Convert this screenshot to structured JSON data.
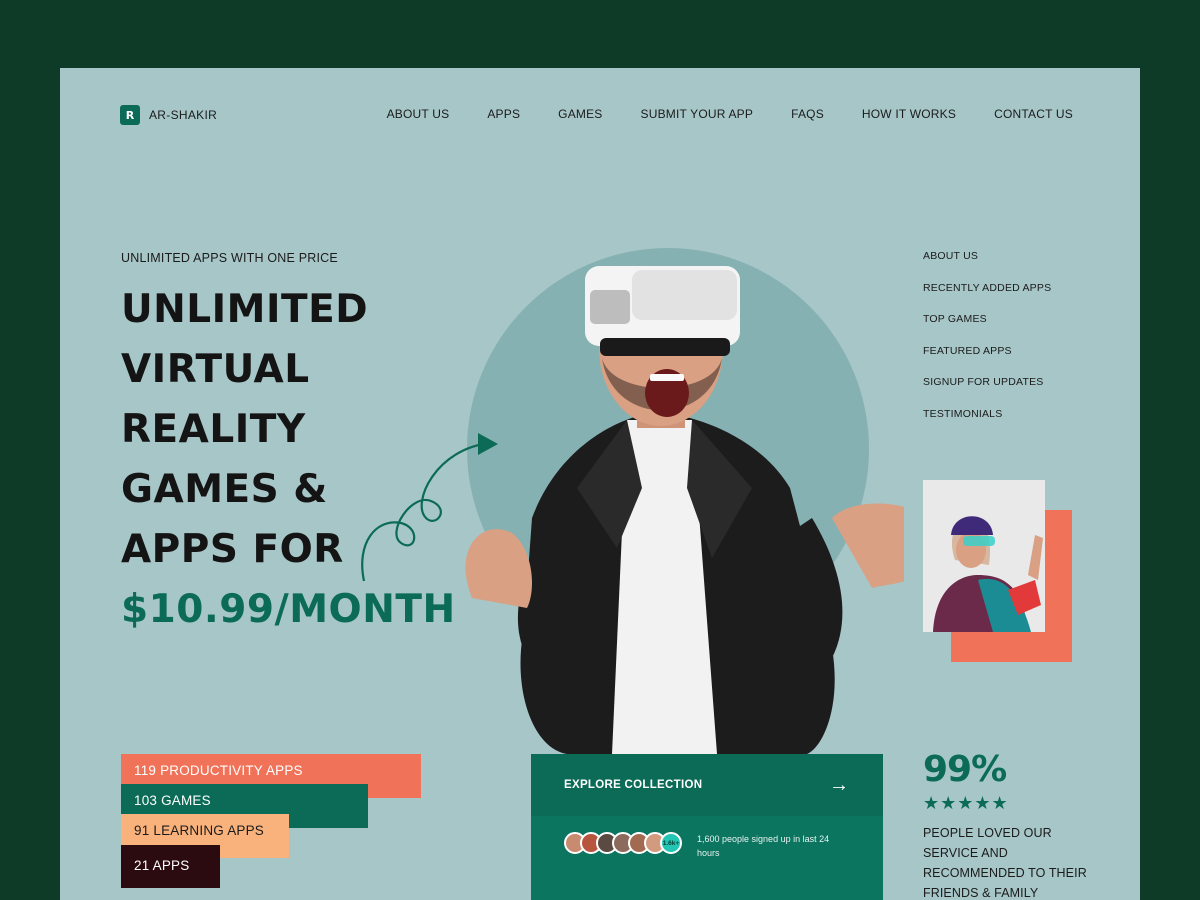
{
  "brand": {
    "name": "AR-SHAKIR",
    "logo_glyph": "R"
  },
  "nav": [
    "ABOUT US",
    "APPS",
    "GAMES",
    "SUBMIT YOUR APP",
    "FAQS",
    "HOW IT WORKS",
    "CONTACT US"
  ],
  "hero": {
    "eyebrow": "UNLIMITED APPS WITH ONE PRICE",
    "headline_lines": [
      "UNLIMITED",
      "VIRTUAL",
      "REALITY",
      "GAMES &",
      "APPS FOR"
    ],
    "price": "$10.99/MONTH"
  },
  "side_menu": [
    "ABOUT US",
    "RECENTLY ADDED APPS",
    "TOP GAMES",
    "FEATURED APPS",
    "SIGNUP FOR UPDATES",
    "TESTIMONIALS"
  ],
  "stats": [
    "119 PRODUCTIVITY APPS",
    "103 GAMES",
    "91 LEARNING APPS",
    "21 APPS"
  ],
  "explore": {
    "label": "EXPLORE COLLECTION",
    "arrow_icon": "→",
    "avatar_count": "1.6k+",
    "signup_text": "1,600 people signed up in last 24 hours"
  },
  "rating": {
    "percent": "99%",
    "stars": "★★★★★",
    "text": "PEOPLE LOVED OUR SERVICE AND RECOMMENDED TO THEIR FRIENDS & FAMILY"
  },
  "colors": {
    "frame": "#0d3b27",
    "page": "#a7c6c8",
    "primary_green": "#0b6b57",
    "coral": "#f07258",
    "peach": "#f9b27c",
    "maroon": "#2b0a10"
  }
}
